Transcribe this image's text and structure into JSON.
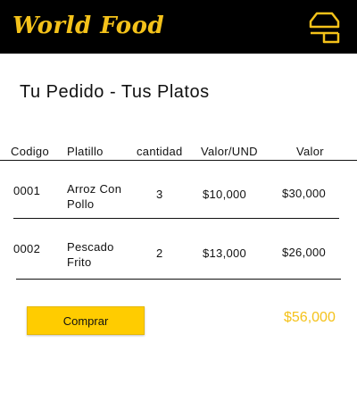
{
  "header": {
    "brand": "World Food",
    "menu_icon": "menu-icon"
  },
  "page": {
    "title": "Tu Pedido - Tus Platos"
  },
  "table": {
    "columns": [
      "Codigo",
      "Platillo",
      "cantidad",
      "Valor/UND",
      "Valor"
    ],
    "rows": [
      {
        "codigo": "0001",
        "platillo": "Arroz Con Pollo",
        "cantidad": "3",
        "valor_und": "$10,000",
        "valor": "$30,000"
      },
      {
        "codigo": "0002",
        "platillo": "Pescado Frito",
        "cantidad": "2",
        "valor_und": "$13,000",
        "valor": "$26,000"
      }
    ]
  },
  "footer": {
    "buy_label": "Comprar",
    "total": "$56,000"
  },
  "colors": {
    "accent": "#f4c21a",
    "button": "#ffcc00",
    "header_bg": "#000000"
  }
}
